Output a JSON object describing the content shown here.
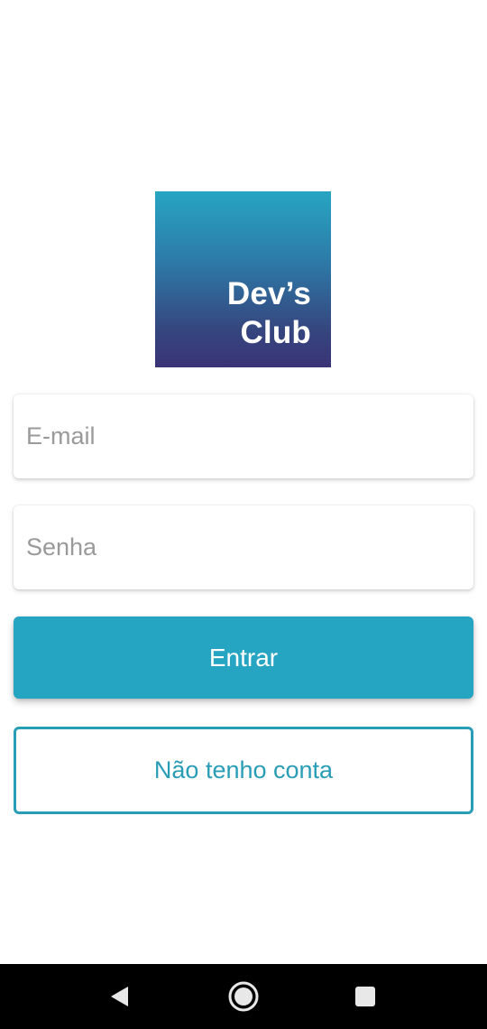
{
  "logo": {
    "line1": "Dev’s",
    "line2": "Club",
    "gradient_top": "#27a5c3",
    "gradient_bottom": "#3a3376"
  },
  "form": {
    "email_placeholder": "E-mail",
    "password_placeholder": "Senha",
    "submit_label": "Entrar",
    "no_account_label": "Não tenho conta",
    "accent_color": "#26a5c3"
  },
  "navbar": {
    "back_icon": "triangle-back-icon",
    "home_icon": "circle-home-icon",
    "recents_icon": "square-recents-icon"
  }
}
